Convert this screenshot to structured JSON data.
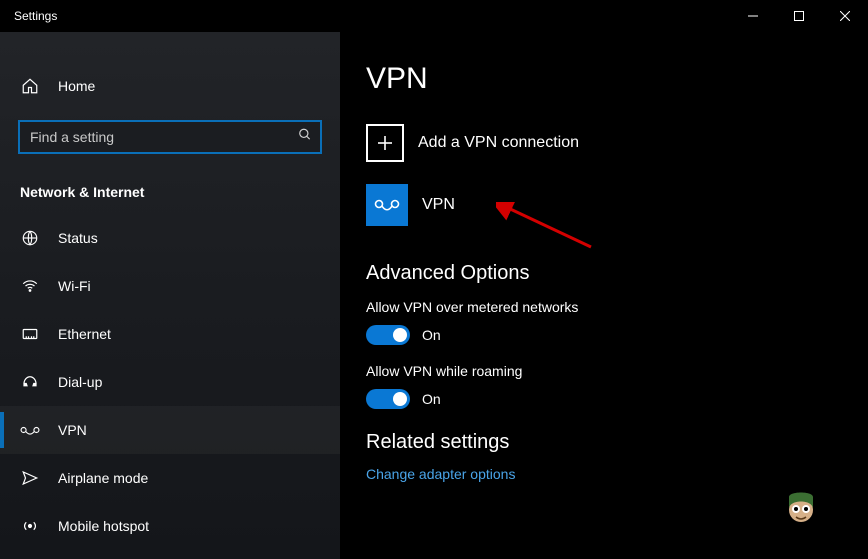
{
  "window": {
    "title": "Settings"
  },
  "sidebar": {
    "home": "Home",
    "search_placeholder": "Find a setting",
    "category": "Network & Internet",
    "items": [
      {
        "label": "Status"
      },
      {
        "label": "Wi-Fi"
      },
      {
        "label": "Ethernet"
      },
      {
        "label": "Dial-up"
      },
      {
        "label": "VPN"
      },
      {
        "label": "Airplane mode"
      },
      {
        "label": "Mobile hotspot"
      }
    ]
  },
  "main": {
    "page_title": "VPN",
    "add_label": "Add a VPN connection",
    "vpn_entry": "VPN",
    "advanced_title": "Advanced Options",
    "opt1_label": "Allow VPN over metered networks",
    "opt1_state": "On",
    "opt2_label": "Allow VPN while roaming",
    "opt2_state": "On",
    "related_title": "Related settings",
    "link1": "Change adapter options"
  }
}
